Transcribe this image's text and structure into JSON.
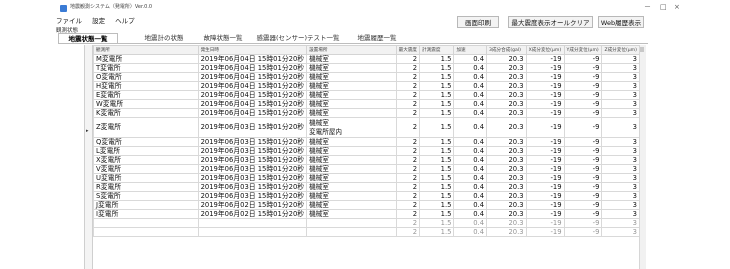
{
  "window": {
    "title": "地震観測システム（発電所）Ver.0.0",
    "controls": [
      "－",
      "□",
      "×"
    ]
  },
  "menu": [
    "ファイル",
    "設定",
    "ヘルプ"
  ],
  "toolbar": {
    "print": "画面印刷",
    "clear_max": "最大震度表示オールクリア",
    "web_history": "Web履歴表示"
  },
  "sub_label": "観測状態",
  "tabs": [
    "地震状態一覧",
    "地震計の状態",
    "故障状態一覧",
    "感震器(センサー)テスト一覧",
    "地震履歴一覧"
  ],
  "active_tab": 0,
  "table": {
    "columns": [
      "観測所",
      "発生日時",
      "設置場所",
      "最大震度",
      "計測震度",
      "加速",
      "3成分合成(gal)",
      "X成分変位(μm)",
      "Y成分変位(μm)",
      "Z成分変位(μm)"
    ],
    "rows": [
      {
        "station": "M変電所",
        "datetime": "2019年06月04日 15時01分20秒",
        "location": [
          "機械室"
        ],
        "vals": [
          "2",
          "1.5",
          "0.4",
          "20.3",
          "-19",
          "-9",
          "3"
        ]
      },
      {
        "station": "T変電所",
        "datetime": "2019年06月04日 15時01分20秒",
        "location": [
          "機械室"
        ],
        "vals": [
          "2",
          "1.5",
          "0.4",
          "20.3",
          "-19",
          "-9",
          "3"
        ]
      },
      {
        "station": "O変電所",
        "datetime": "2019年06月04日 15時01分20秒",
        "location": [
          "機械室"
        ],
        "vals": [
          "2",
          "1.5",
          "0.4",
          "20.3",
          "-19",
          "-9",
          "3"
        ]
      },
      {
        "station": "H変電所",
        "datetime": "2019年06月04日 15時01分20秒",
        "location": [
          "機械室"
        ],
        "vals": [
          "2",
          "1.5",
          "0.4",
          "20.3",
          "-19",
          "-9",
          "3"
        ]
      },
      {
        "station": "E変電所",
        "datetime": "2019年06月04日 15時01分20秒",
        "location": [
          "機械室"
        ],
        "vals": [
          "2",
          "1.5",
          "0.4",
          "20.3",
          "-19",
          "-9",
          "3"
        ]
      },
      {
        "station": "W変電所",
        "datetime": "2019年06月04日 15時01分20秒",
        "location": [
          "機械室"
        ],
        "vals": [
          "2",
          "1.5",
          "0.4",
          "20.3",
          "-19",
          "-9",
          "3"
        ]
      },
      {
        "station": "K変電所",
        "datetime": "2019年06月04日 15時01分20秒",
        "location": [
          "機械室"
        ],
        "vals": [
          "2",
          "1.5",
          "0.4",
          "20.3",
          "-19",
          "-9",
          "3"
        ]
      },
      {
        "station": "Z変電所",
        "datetime": "2019年06月03日 15時01分20秒",
        "location": [
          "機械室",
          "変電所屋内"
        ],
        "vals": [
          "2",
          "1.5",
          "0.4",
          "20.3",
          "-19",
          "-9",
          "3"
        ],
        "tall": true
      },
      {
        "station": "Q変電所",
        "datetime": "2019年06月03日 15時01分20秒",
        "location": [
          "機械室"
        ],
        "vals": [
          "2",
          "1.5",
          "0.4",
          "20.3",
          "-19",
          "-9",
          "3"
        ]
      },
      {
        "station": "L変電所",
        "datetime": "2019年06月03日 15時01分20秒",
        "location": [
          "機械室"
        ],
        "vals": [
          "2",
          "1.5",
          "0.4",
          "20.3",
          "-19",
          "-9",
          "3"
        ]
      },
      {
        "station": "X変電所",
        "datetime": "2019年06月03日 15時01分20秒",
        "location": [
          "機械室"
        ],
        "vals": [
          "2",
          "1.5",
          "0.4",
          "20.3",
          "-19",
          "-9",
          "3"
        ]
      },
      {
        "station": "V変電所",
        "datetime": "2019年06月03日 15時01分20秒",
        "location": [
          "機械室"
        ],
        "vals": [
          "2",
          "1.5",
          "0.4",
          "20.3",
          "-19",
          "-9",
          "3"
        ]
      },
      {
        "station": "U変電所",
        "datetime": "2019年06月03日 15時01分20秒",
        "location": [
          "機械室"
        ],
        "vals": [
          "2",
          "1.5",
          "0.4",
          "20.3",
          "-19",
          "-9",
          "3"
        ]
      },
      {
        "station": "R変電所",
        "datetime": "2019年06月03日 15時01分20秒",
        "location": [
          "機械室"
        ],
        "vals": [
          "2",
          "1.5",
          "0.4",
          "20.3",
          "-19",
          "-9",
          "3"
        ]
      },
      {
        "station": "S変電所",
        "datetime": "2019年06月03日 15時01分20秒",
        "location": [
          "機械室"
        ],
        "vals": [
          "2",
          "1.5",
          "0.4",
          "20.3",
          "-19",
          "-9",
          "3"
        ]
      },
      {
        "station": "J変電所",
        "datetime": "2019年06月02日 15時01分20秒",
        "location": [
          "機械室"
        ],
        "vals": [
          "2",
          "1.5",
          "0.4",
          "20.3",
          "-19",
          "-9",
          "3"
        ]
      },
      {
        "station": "I変電所",
        "datetime": "2019年06月02日 15時01分20秒",
        "location": [
          "機械室"
        ],
        "vals": [
          "2",
          "1.5",
          "0.4",
          "20.3",
          "-19",
          "-9",
          "3"
        ]
      },
      {
        "station": "",
        "datetime": "",
        "location": [
          ""
        ],
        "vals": [
          "2",
          "1.5",
          "0.4",
          "20.3",
          "-19",
          "-9",
          "3"
        ]
      },
      {
        "station": "",
        "datetime": "",
        "location": [
          ""
        ],
        "vals": [
          "2",
          "1.5",
          "0.4",
          "20.3",
          "-19",
          "-9",
          "3"
        ]
      }
    ]
  }
}
